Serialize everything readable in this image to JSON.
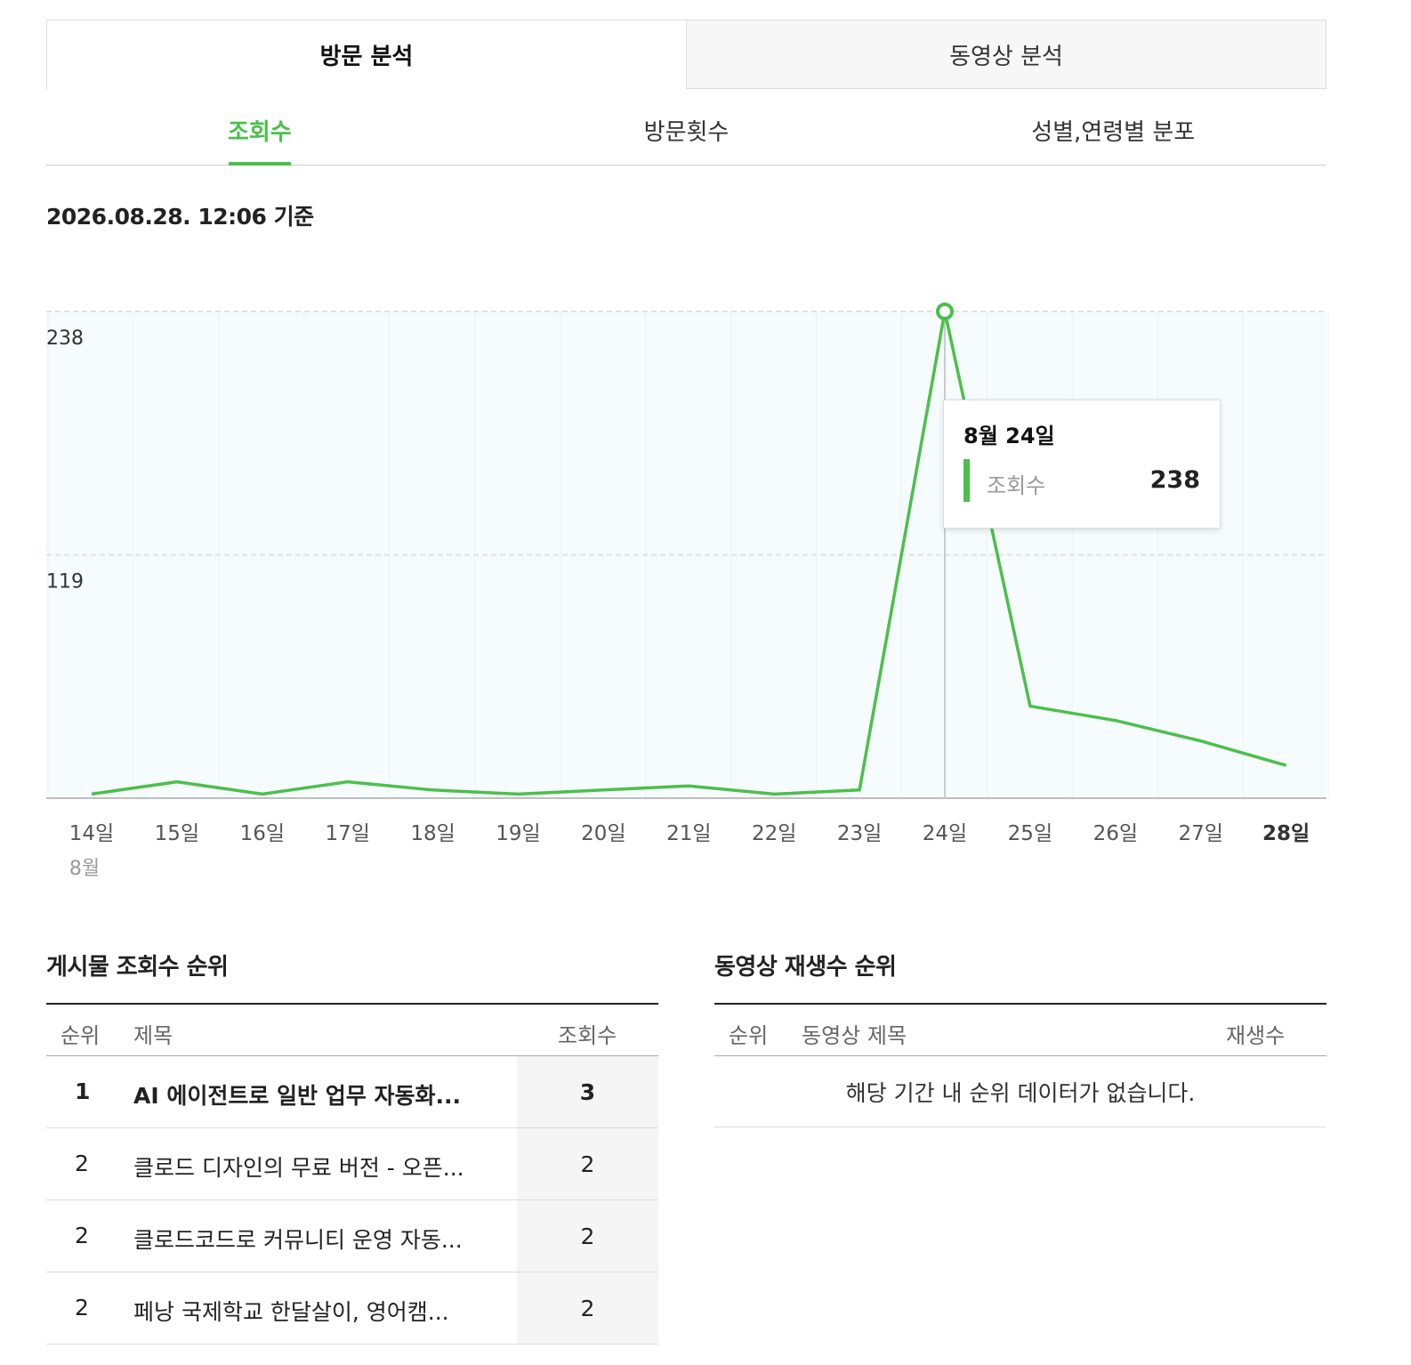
{
  "main_tabs": [
    {
      "label": "방문 분석",
      "active": true
    },
    {
      "label": "동영상 분석",
      "active": false
    }
  ],
  "sub_tabs": [
    {
      "label": "조회수",
      "active": true
    },
    {
      "label": "방문횟수",
      "active": false
    },
    {
      "label": "성별,연령별 분포",
      "active": false
    }
  ],
  "timestamp": "2026.08.28. 12:06 기준",
  "colors": {
    "accent": "#4cbf4c",
    "plot_bg": "#f6fbfd"
  },
  "chart_data": {
    "type": "line",
    "series": [
      {
        "name": "조회수",
        "values": [
          2,
          8,
          2,
          8,
          4,
          2,
          4,
          6,
          2,
          4,
          238,
          45,
          38,
          28,
          16
        ]
      }
    ],
    "categories": [
      "14일",
      "15일",
      "16일",
      "17일",
      "18일",
      "19일",
      "20일",
      "21일",
      "22일",
      "23일",
      "24일",
      "25일",
      "26일",
      "27일",
      "28일"
    ],
    "month_label": "8월",
    "y_ticks": [
      "238",
      "119"
    ],
    "ylim": [
      0,
      238
    ],
    "highlight_index": 10,
    "bold_last_category": true
  },
  "tooltip": {
    "title": "8월 24일",
    "label": "조회수",
    "value": "238"
  },
  "post_ranking": {
    "title": "게시물 조회수 순위",
    "headers": {
      "rank": "순위",
      "title": "제목",
      "count": "조회수"
    },
    "rows": [
      {
        "rank": "1",
        "title": "AI 에이전트로 일반 업무 자동화...",
        "count": "3"
      },
      {
        "rank": "2",
        "title": "클로드 디자인의 무료 버전 - 오픈...",
        "count": "2"
      },
      {
        "rank": "2",
        "title": "클로드코드로 커뮤니티 운영 자동...",
        "count": "2"
      },
      {
        "rank": "2",
        "title": "페낭 국제학교 한달살이, 영어캠...",
        "count": "2"
      }
    ]
  },
  "video_ranking": {
    "title": "동영상 재생수 순위",
    "headers": {
      "rank": "순위",
      "title": "동영상 제목",
      "count": "재생수"
    },
    "empty_message": "해당 기간 내 순위 데이터가 없습니다."
  }
}
